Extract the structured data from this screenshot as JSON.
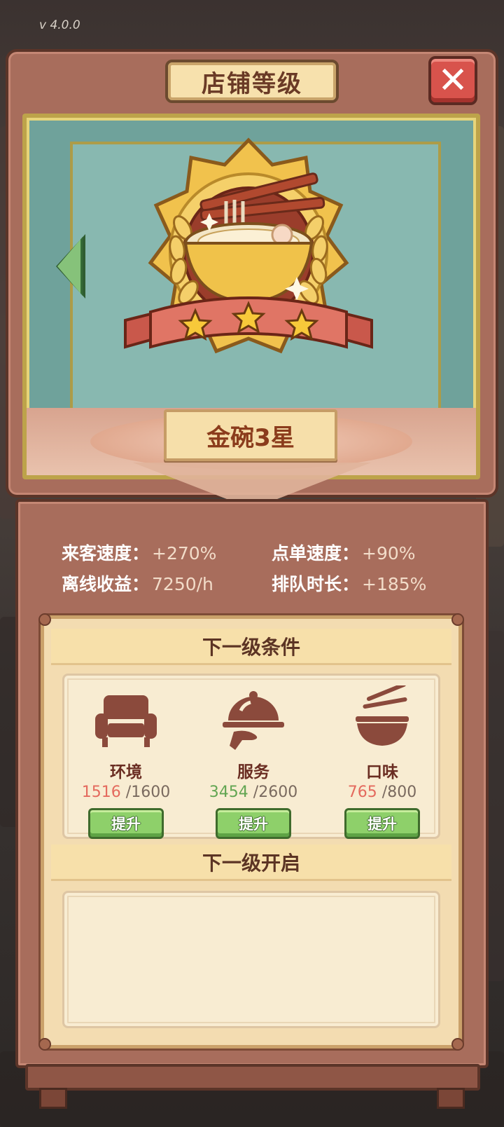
{
  "version": "v 4.0.0",
  "dialog": {
    "title": "店铺等级",
    "close_label": "✕"
  },
  "badge": {
    "name": "金碗3星",
    "stars": 3
  },
  "stats": [
    {
      "label": "来客速度：",
      "value": "+270%"
    },
    {
      "label": "点单速度：",
      "value": "+90%"
    },
    {
      "label": "离线收益：",
      "value": "7250/h"
    },
    {
      "label": "排队时长：",
      "value": "+185%"
    }
  ],
  "next_conditions": {
    "title": "下一级条件",
    "items": [
      {
        "name": "环境",
        "current": "1516",
        "target": "/1600",
        "met": false,
        "button": "提升",
        "icon": "armchair-icon"
      },
      {
        "name": "服务",
        "current": "3454",
        "target": "/2600",
        "met": true,
        "button": "提升",
        "icon": "cloche-tray-icon"
      },
      {
        "name": "口味",
        "current": "765",
        "target": "/800",
        "met": false,
        "button": "提升",
        "icon": "noodle-bowl-icon"
      }
    ]
  },
  "next_unlock": {
    "title": "下一级开启"
  },
  "colors": {
    "frame": "#a86d5c",
    "frame_border": "#5b3428",
    "panel": "#f3dcb1",
    "button_green": "#8ed06a",
    "close_red": "#d8534c",
    "progress_low": "#e46a5e",
    "progress_ok": "#62a552"
  }
}
